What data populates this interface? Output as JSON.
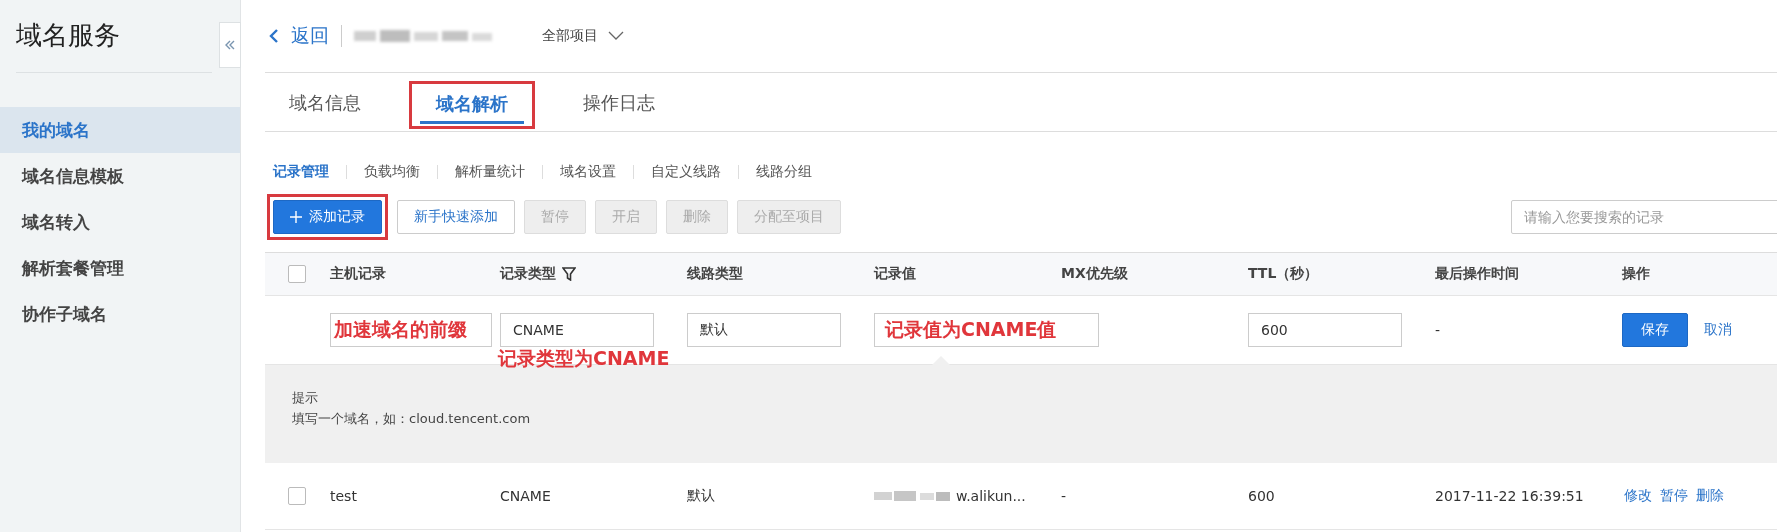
{
  "sidebar": {
    "title": "域名服务",
    "items": [
      {
        "label": "我的域名",
        "selected": true
      },
      {
        "label": "域名信息模板",
        "selected": false
      },
      {
        "label": "域名转入",
        "selected": false
      },
      {
        "label": "解析套餐管理",
        "selected": false
      },
      {
        "label": "协作子域名",
        "selected": false
      }
    ]
  },
  "header": {
    "back": "返回",
    "project": "全部项目"
  },
  "tabs": [
    {
      "label": "域名信息",
      "selected": false,
      "highlighted": false
    },
    {
      "label": "域名解析",
      "selected": true,
      "highlighted": true
    },
    {
      "label": "操作日志",
      "selected": false,
      "highlighted": false
    }
  ],
  "subtabs": [
    {
      "label": "记录管理",
      "selected": true
    },
    {
      "label": "负载均衡",
      "selected": false
    },
    {
      "label": "解析量统计",
      "selected": false
    },
    {
      "label": "域名设置",
      "selected": false
    },
    {
      "label": "自定义线路",
      "selected": false
    },
    {
      "label": "线路分组",
      "selected": false
    }
  ],
  "toolbar": [
    {
      "label": "添加记录",
      "kind": "primary",
      "highlighted": true
    },
    {
      "label": "新手快速添加",
      "kind": "default",
      "highlighted": false
    },
    {
      "label": "暂停",
      "kind": "disabled",
      "highlighted": false
    },
    {
      "label": "开启",
      "kind": "disabled",
      "highlighted": false
    },
    {
      "label": "删除",
      "kind": "disabled",
      "highlighted": false
    },
    {
      "label": "分配至项目",
      "kind": "disabled",
      "highlighted": false
    }
  ],
  "search": {
    "placeholder": "请输入您要搜索的记录"
  },
  "table": {
    "all_checked": false,
    "columns": [
      {
        "label": "主机记录",
        "filter": false
      },
      {
        "label": "记录类型",
        "filter": true
      },
      {
        "label": "线路类型",
        "filter": false
      },
      {
        "label": "记录值",
        "filter": false
      },
      {
        "label": "MX优先级",
        "filter": false
      },
      {
        "label": "TTL（秒）",
        "filter": false
      },
      {
        "label": "最后操作时间",
        "filter": false
      },
      {
        "label": "操作",
        "filter": false
      }
    ],
    "edit_row": {
      "host_annotation": "加速域名的前缀",
      "type": "CNAME",
      "type_annotation": "记录类型为CNAME",
      "line": "默认",
      "value_annotation": "记录值为CNAME值",
      "ttl": "600",
      "time": "-",
      "save": "保存",
      "cancel": "取消"
    },
    "hint": {
      "title": "提示",
      "text": "填写一个域名，如：cloud.tencent.com"
    },
    "rows": [
      {
        "checked": false,
        "host": "test",
        "type": "CNAME",
        "line": "默认",
        "value": "w.alikun...",
        "mx": "-",
        "ttl": "600",
        "time": "2017-11-22 16:39:51",
        "actions": [
          "修改",
          "暂停",
          "删除"
        ]
      }
    ]
  }
}
